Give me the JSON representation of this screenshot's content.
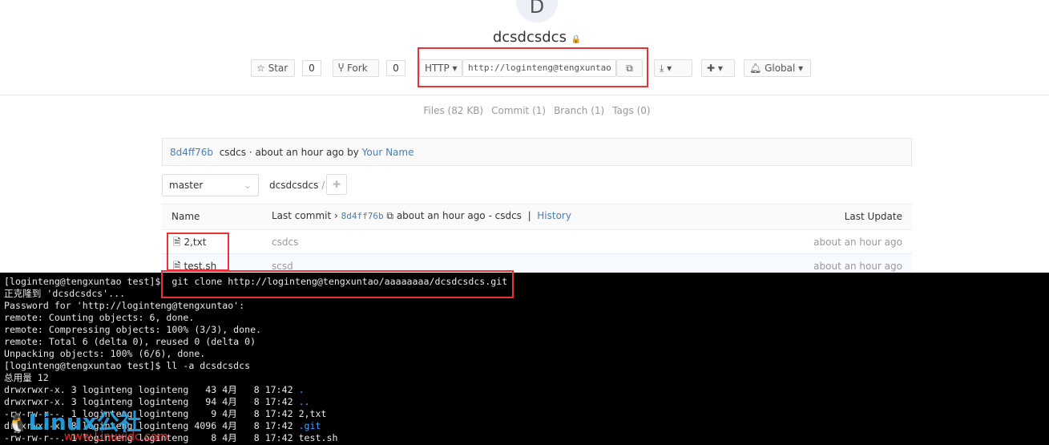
{
  "repo": {
    "avatar_letter": "D",
    "name": "dcsdcsdcs"
  },
  "actions": {
    "star_label": "Star",
    "star_count": "0",
    "fork_label": "Fork",
    "fork_count": "0",
    "protocol": "HTTP",
    "clone_url": "http://loginteng@tengxuntao",
    "notify_label": "Global"
  },
  "tabs": [
    "Files (82 KB)",
    "Commit (1)",
    "Branch (1)",
    "Tags (0)"
  ],
  "last_commit": {
    "sha": "8d4ff76b",
    "message": "csdcs · about an hour ago by",
    "author": "Your Name"
  },
  "branch": "master",
  "path": "dcsdcsdcs",
  "path_sep": "/",
  "table": {
    "name_header": "Name",
    "last_commit_label": "Last commit ›",
    "sha": "8d4ff76b",
    "commit_info": "about an hour ago - csdcs",
    "history": "History",
    "last_update_header": "Last Update",
    "rows": [
      {
        "name": "2,txt",
        "msg": "csdcs",
        "time": "about an hour ago"
      },
      {
        "name": "test.sh",
        "msg": "scsd",
        "time": "about an hour ago"
      }
    ]
  },
  "terminal": {
    "lines": [
      "[loginteng@tengxuntao test]$  git clone http://loginteng@tengxuntao/aaaaaaaa/dcsdcsdcs.git",
      "正克隆到 'dcsdcsdcs'...",
      "Password for 'http://loginteng@tengxuntao':",
      "remote: Counting objects: 6, done.",
      "remote: Compressing objects: 100% (3/3), done.",
      "remote: Total 6 (delta 0), reused 0 (delta 0)",
      "Unpacking objects: 100% (6/6), done.",
      "[loginteng@tengxuntao test]$ ll -a dcsdcsdcs",
      "总用量 12",
      "drwxrwxr-x. 3 loginteng loginteng   43 4月   8 17:42 ",
      "drwxrwxr-x. 3 loginteng loginteng   94 4月   8 17:42 ",
      "-rw-rw-r--. 1 loginteng loginteng    9 4月   8 17:42 2,txt",
      "drwxrwxr-x. 8 loginteng loginteng 4096 4月   8 17:42 ",
      "-rw-rw-r--. 1 loginteng loginteng    8 4月   8 17:42 test.sh"
    ],
    "blue_names": [
      ".",
      "..",
      ".git"
    ]
  },
  "watermark": {
    "logo": "Linux公社",
    "url": "www.Linuxidc.com"
  }
}
